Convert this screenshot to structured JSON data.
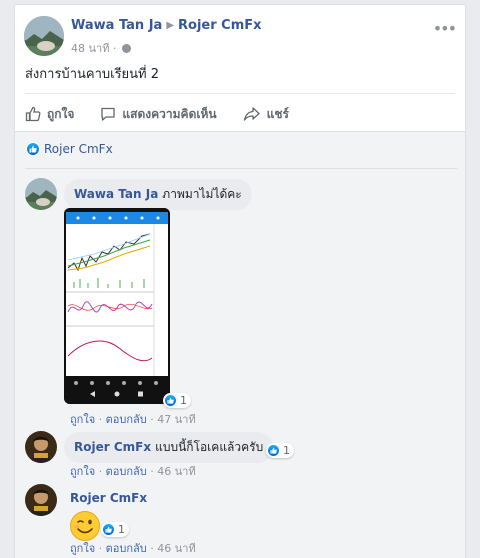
{
  "post": {
    "author": "Wawa Tan Ja",
    "target": "Rojer CmFx",
    "time": "48 นาที",
    "text": "ส่งการบ้านคาบเรียนที่ 2",
    "actions": {
      "like": "ถูกใจ",
      "comment": "แสดงความคิดเห็น",
      "share": "แชร์"
    }
  },
  "liked_by": "Rojer CmFx",
  "comments": [
    {
      "author": "Wawa Tan Ja",
      "text": "ภาพมาไม่ได้คะ",
      "like": "ถูกใจ",
      "reply": "ตอบกลับ",
      "time": "47 นาที",
      "reactions": "1"
    },
    {
      "author": "Rojer CmFx",
      "text": "แบบนี้ก็โอเคแล้วครับ",
      "like": "ถูกใจ",
      "reply": "ตอบกลับ",
      "time": "46 นาที",
      "reactions": "1"
    },
    {
      "author": "Rojer CmFx",
      "text": "",
      "like": "ถูกใจ",
      "reply": "ตอบกลับ",
      "time": "46 นาที",
      "reactions": "1"
    }
  ],
  "colors": {
    "link": "#365899",
    "meta": "#90949c",
    "like": "#0062df",
    "bubble": "#e9ebee"
  }
}
